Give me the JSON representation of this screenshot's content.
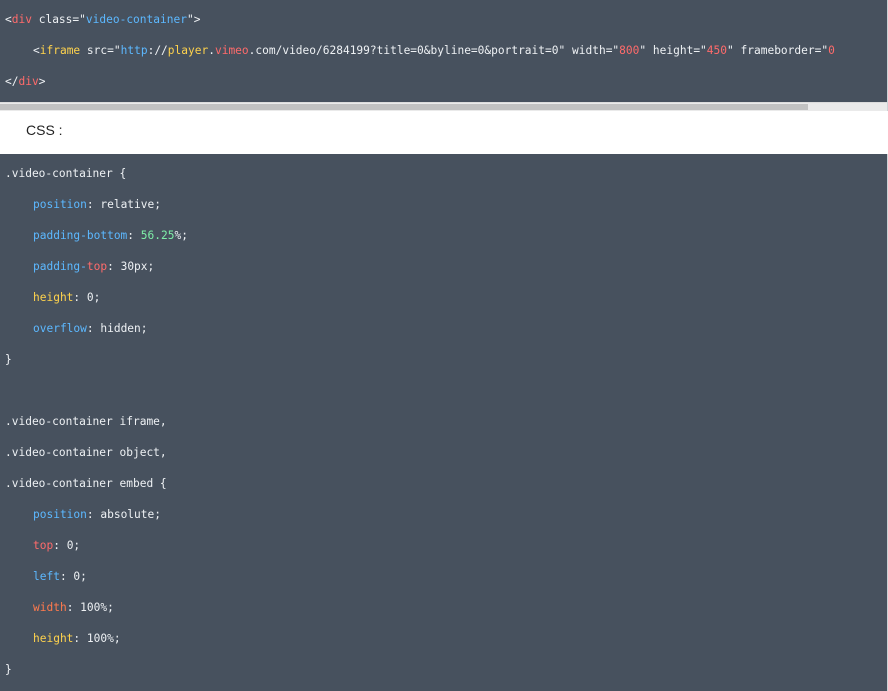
{
  "html_code": {
    "line1": {
      "lt": "<",
      "tag": "div",
      "sp": " ",
      "attr": "class",
      "eq": "=",
      "q1": "\"",
      "val": "video-container",
      "q2": "\"",
      "gt": ">"
    },
    "line2": {
      "lt": "<",
      "tag": "iframe",
      "sp1": " ",
      "attr_src": "src",
      "eq1": "=\"",
      "url_http": "http",
      "url_sep": "://",
      "url_player": "player",
      "url_dot1": ".",
      "url_vimeo": "vimeo",
      "url_rest": ".com/video/6284199?title=0&byline=0&portrait=0",
      "q_end1": "\"",
      "sp2": " ",
      "attr_width": "width",
      "eq2": "=\"",
      "val_width": "800",
      "q_end2": "\"",
      "sp3": " ",
      "attr_height": "height",
      "eq3": "=\"",
      "val_height": "450",
      "q_end3": "\"",
      "sp4": " ",
      "attr_frameborder": "frameborder",
      "eq4": "=\"",
      "val_frameborder": "0"
    },
    "line3": {
      "lt": "</",
      "tag": "div",
      "gt": ">"
    }
  },
  "css_label": "CSS :",
  "css_code": {
    "sel1": ".video-container {",
    "r1": {
      "prop": "position",
      "rest": ": relative;"
    },
    "r2": {
      "prop": "padding-bottom",
      "colon": ": ",
      "num": "56.25",
      "rest": "%;"
    },
    "r3": {
      "prop_a": "padding-",
      "prop_b": "top",
      "rest": ": 30px;"
    },
    "r4": {
      "prop": "height",
      "rest": ": 0;"
    },
    "r5": {
      "prop": "overflow",
      "rest": ": hidden;"
    },
    "close1": "}",
    "sel2a": ".video-container iframe,",
    "sel2b": ".video-container object,",
    "sel2c": ".video-container embed {",
    "r6": {
      "prop": "position",
      "rest": ": absolute;"
    },
    "r7": {
      "prop": "top",
      "rest": ": 0;"
    },
    "r8": {
      "prop": "left",
      "rest": ": 0;"
    },
    "r9": {
      "prop": "width",
      "rest": ": 100%;"
    },
    "r10": {
      "prop": "height",
      "rest": ": 100%;"
    },
    "close2": "}"
  }
}
